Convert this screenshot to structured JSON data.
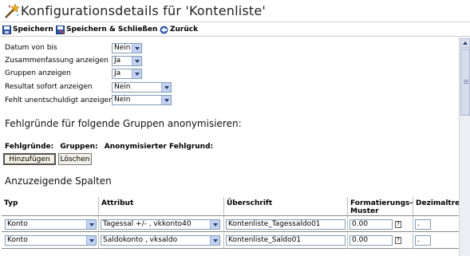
{
  "title": "Konfigurationsdetails für 'Kontenliste'",
  "toolbar": {
    "save": "Speichern",
    "save_close": "Speichern & Schließen",
    "back": "Zurück"
  },
  "form": {
    "rows": [
      {
        "label": "Datum von bis",
        "value": "Nein"
      },
      {
        "label": "Zusammenfassung anzeigen",
        "value": "Ja"
      },
      {
        "label": "Gruppen anzeigen",
        "value": "Ja"
      },
      {
        "label": "Resultat sofort anzeigen",
        "value": "Nein"
      },
      {
        "label": "Fehlt unentschuldigt anzeigen",
        "value": "Nein"
      }
    ]
  },
  "anonymize": {
    "heading": "Fehlgründe für folgende Gruppen anonymisieren:",
    "col1": "Fehlgründe:",
    "col2": "Gruppen:",
    "col3": "Anonymisierter Fehlgrund:",
    "add": "Hinzufügen",
    "delete": "Löschen"
  },
  "columns": {
    "heading": "Anzuzeigende Spalten",
    "headers": {
      "typ": "Typ",
      "attribut": "Attribut",
      "ueberschrift": "Überschrift",
      "format": "Formatierungs-\nMuster",
      "dezimal": "Dezimaltre"
    },
    "rows": [
      {
        "typ": "Konto",
        "attribut": "Tagessal +/- , vkkonto40",
        "ueberschrift": "Kontenliste_Tagessaldo01",
        "format": "0.00",
        "dezimal": "."
      },
      {
        "typ": "Konto",
        "attribut": "Saldokonto , vksaldo",
        "ueberschrift": "Kontenliste_Saldo01",
        "format": "0.00",
        "dezimal": "."
      }
    ]
  },
  "colors": {
    "toolbar_icon": "#2d58a8",
    "title_icon": "#d8a020"
  }
}
